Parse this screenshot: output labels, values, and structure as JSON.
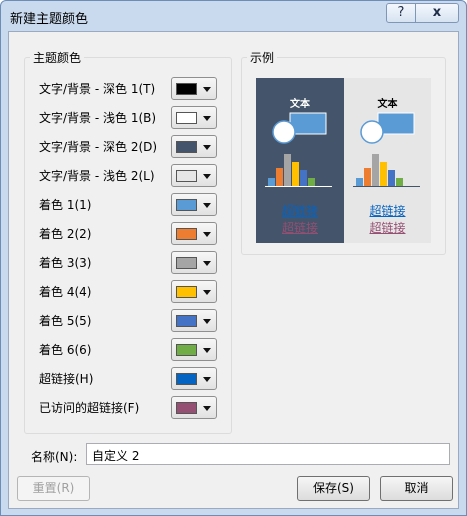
{
  "window": {
    "title": "新建主题颜色",
    "help_label": "?",
    "close_label": "x"
  },
  "theme_colors": {
    "label": "主题颜色",
    "rows": [
      {
        "label": "文字/背景 - 深色 1(T)",
        "color": "#000000"
      },
      {
        "label": "文字/背景 - 浅色 1(B)",
        "color": "#ffffff"
      },
      {
        "label": "文字/背景 - 深色 2(D)",
        "color": "#44546a"
      },
      {
        "label": "文字/背景 - 浅色 2(L)",
        "color": "#e7e6e6"
      },
      {
        "label": "着色 1(1)",
        "color": "#5b9bd5"
      },
      {
        "label": "着色 2(2)",
        "color": "#ed7d31"
      },
      {
        "label": "着色 3(3)",
        "color": "#a5a5a5"
      },
      {
        "label": "着色 4(4)",
        "color": "#ffc000"
      },
      {
        "label": "着色 5(5)",
        "color": "#4472c4"
      },
      {
        "label": "着色 6(6)",
        "color": "#70ad47"
      },
      {
        "label": "超链接(H)",
        "color": "#0563c1"
      },
      {
        "label": "已访问的超链接(F)",
        "color": "#954f72"
      }
    ]
  },
  "sample": {
    "label": "示例",
    "dark_panel": {
      "text": "文本",
      "hyperlink": "超链接",
      "visited": "超链接"
    },
    "light_panel": {
      "text": "文本",
      "hyperlink": "超链接",
      "visited": "超链接"
    }
  },
  "name_field": {
    "label": "名称(N):",
    "value": "自定义 2"
  },
  "buttons": {
    "reset": "重置(R)",
    "save": "保存(S)",
    "cancel": "取消"
  }
}
